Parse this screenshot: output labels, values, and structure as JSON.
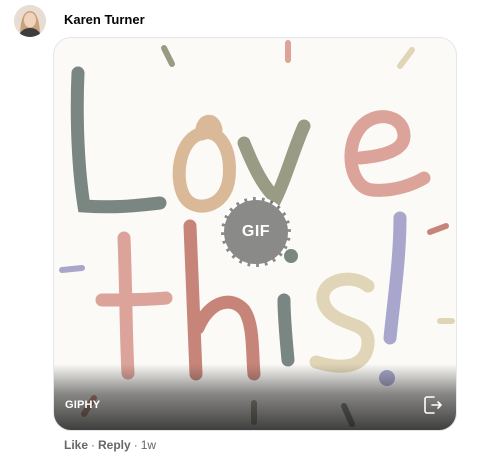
{
  "comment": {
    "author": "Karen Turner",
    "gif": {
      "provider": "GIPHY",
      "badge_label": "GIF",
      "share_icon": "share-icon",
      "colors": {
        "sage": "#7a8681",
        "tan": "#d9b998",
        "olive": "#9a9b84",
        "pink": "#dba39a",
        "rose": "#c7857a",
        "lilac": "#a8a6cc",
        "cream": "#e0d5b7"
      }
    },
    "actions": {
      "like": "Like",
      "separator": "·",
      "reply": "Reply",
      "time": "1w"
    }
  }
}
